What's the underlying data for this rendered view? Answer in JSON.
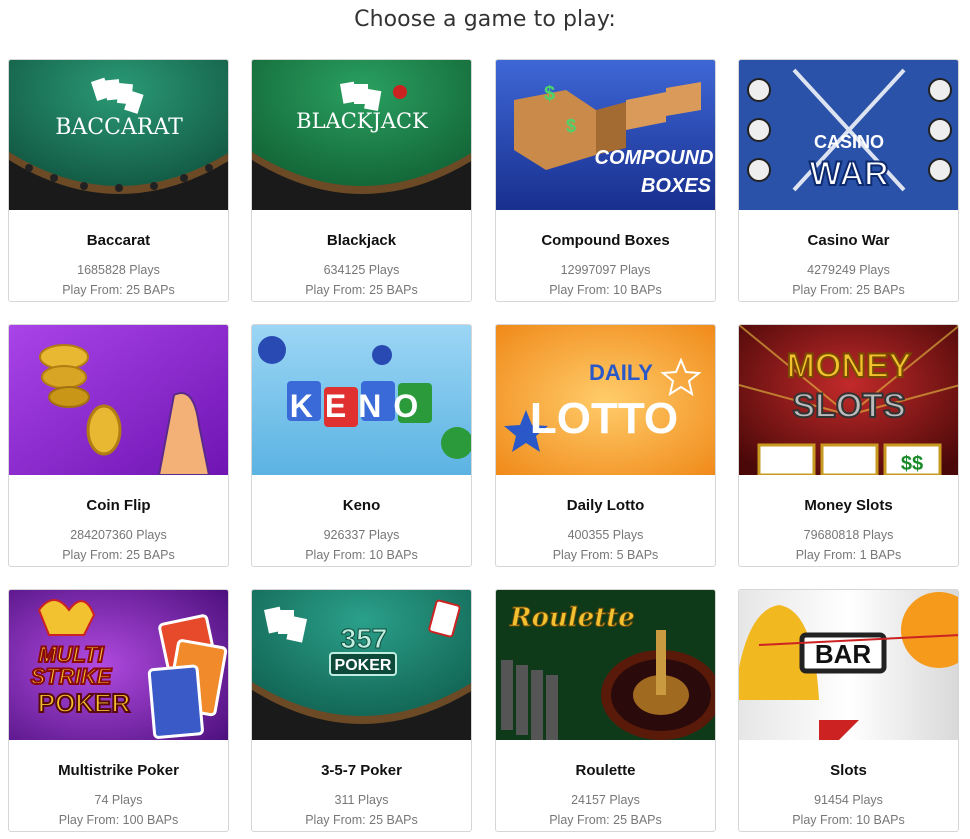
{
  "page": {
    "heading": "Choose a game to play:"
  },
  "games": [
    {
      "title": "Baccarat",
      "plays": "1685828 Plays",
      "from": "Play From: 25 BAPs",
      "art": "BACCARAT"
    },
    {
      "title": "Blackjack",
      "plays": "634125 Plays",
      "from": "Play From: 25 BAPs",
      "art": "BLACKJACK"
    },
    {
      "title": "Compound Boxes",
      "plays": "12997097 Plays",
      "from": "Play From: 10 BAPs",
      "art1": "COMPOUND",
      "art2": "BOXES"
    },
    {
      "title": "Casino War",
      "plays": "4279249 Plays",
      "from": "Play From: 25 BAPs",
      "art1": "CASINO",
      "art2": "WAR"
    },
    {
      "title": "Coin Flip",
      "plays": "284207360 Plays",
      "from": "Play From: 25 BAPs"
    },
    {
      "title": "Keno",
      "plays": "926337 Plays",
      "from": "Play From: 10 BAPs",
      "art": "KENO"
    },
    {
      "title": "Daily Lotto",
      "plays": "400355 Plays",
      "from": "Play From: 5 BAPs",
      "art1": "DAILY",
      "art2": "LOTTO"
    },
    {
      "title": "Money Slots",
      "plays": "79680818 Plays",
      "from": "Play From: 1 BAPs",
      "art1": "MONEY",
      "art2": "SLOTS"
    },
    {
      "title": "Multistrike Poker",
      "plays": "74 Plays",
      "from": "Play From: 100 BAPs",
      "art1": "MULTI",
      "art2": "STRIKE",
      "art3": "POKER"
    },
    {
      "title": "3-5-7 Poker",
      "plays": "311 Plays",
      "from": "Play From: 25 BAPs",
      "art1": "357",
      "art2": "POKER"
    },
    {
      "title": "Roulette",
      "plays": "24157 Plays",
      "from": "Play From: 25 BAPs",
      "art": "Roulette"
    },
    {
      "title": "Slots",
      "plays": "91454 Plays",
      "from": "Play From: 10 BAPs",
      "art": "BAR"
    }
  ],
  "colors": {
    "felt_green": "#1f7a5e",
    "compound_blue": "#1f3fa8",
    "war_blue": "#2a52a8",
    "coinflip_purple": "#8e2bd6",
    "keno_sky": "#7fc6ea",
    "lotto_orange": "#f59a2a",
    "slots_red": "#7a1010"
  }
}
